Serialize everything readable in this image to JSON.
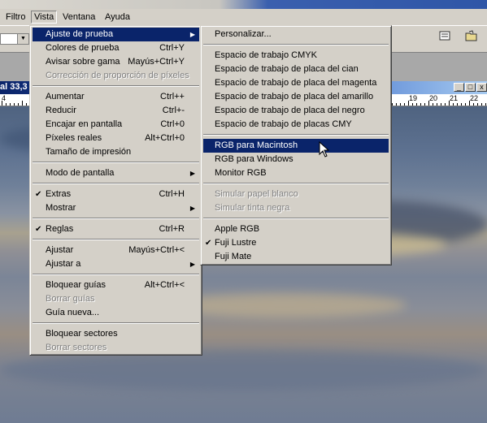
{
  "menubar": {
    "items": [
      "Filtro",
      "Vista",
      "Ventana",
      "Ayuda"
    ],
    "active": "Vista"
  },
  "document": {
    "title": "al 33,3"
  },
  "ruler": {
    "labels": [
      "4",
      "19",
      "20",
      "21",
      "22"
    ]
  },
  "vista_menu": [
    {
      "label": "Ajuste de prueba",
      "submenu": true,
      "highlighted": true
    },
    {
      "label": "Colores de prueba",
      "shortcut": "Ctrl+Y"
    },
    {
      "label": "Avisar sobre gama",
      "shortcut": "Mayús+Ctrl+Y"
    },
    {
      "label": "Corrección de proporción de píxeles",
      "disabled": true
    },
    {
      "separator": true
    },
    {
      "label": "Aumentar",
      "shortcut": "Ctrl++"
    },
    {
      "label": "Reducir",
      "shortcut": "Ctrl+-"
    },
    {
      "label": "Encajar en pantalla",
      "shortcut": "Ctrl+0"
    },
    {
      "label": "Píxeles reales",
      "shortcut": "Alt+Ctrl+0"
    },
    {
      "label": "Tamaño de impresión"
    },
    {
      "separator": true
    },
    {
      "label": "Modo de pantalla",
      "submenu": true
    },
    {
      "separator": true
    },
    {
      "label": "Extras",
      "shortcut": "Ctrl+H",
      "checked": true
    },
    {
      "label": "Mostrar",
      "submenu": true
    },
    {
      "separator": true
    },
    {
      "label": "Reglas",
      "shortcut": "Ctrl+R",
      "checked": true
    },
    {
      "separator": true
    },
    {
      "label": "Ajustar",
      "shortcut": "Mayús+Ctrl+<"
    },
    {
      "label": "Ajustar a",
      "submenu": true
    },
    {
      "separator": true
    },
    {
      "label": "Bloquear guías",
      "shortcut": "Alt+Ctrl+<"
    },
    {
      "label": "Borrar guías",
      "disabled": true
    },
    {
      "label": "Guía nueva..."
    },
    {
      "separator": true
    },
    {
      "label": "Bloquear sectores"
    },
    {
      "label": "Borrar sectores",
      "disabled": true
    }
  ],
  "proof_setup_submenu": [
    {
      "label": "Personalizar..."
    },
    {
      "separator": true
    },
    {
      "label": "Espacio de trabajo CMYK"
    },
    {
      "label": "Espacio de trabajo de placa del cian"
    },
    {
      "label": "Espacio de trabajo de placa del magenta"
    },
    {
      "label": "Espacio de trabajo de placa del amarillo"
    },
    {
      "label": "Espacio de trabajo de placa del negro"
    },
    {
      "label": "Espacio de trabajo de placas CMY"
    },
    {
      "separator": true
    },
    {
      "label": "RGB para Macintosh",
      "highlighted": true
    },
    {
      "label": "RGB para Windows"
    },
    {
      "label": "Monitor RGB"
    },
    {
      "separator": true
    },
    {
      "label": "Simular papel blanco",
      "disabled": true
    },
    {
      "label": "Simular tinta negra",
      "disabled": true
    },
    {
      "separator": true
    },
    {
      "label": "Apple RGB"
    },
    {
      "label": "Fuji Lustre",
      "checked": true
    },
    {
      "label": "Fuji Mate"
    }
  ],
  "colors": {
    "highlight": "#0a246a",
    "menu_bg": "#d4d0c8",
    "disabled": "#808080"
  },
  "icons": {
    "check": "✔",
    "submenu": "▶",
    "toolbar": [
      "palette-icon",
      "file-browser-icon"
    ]
  }
}
